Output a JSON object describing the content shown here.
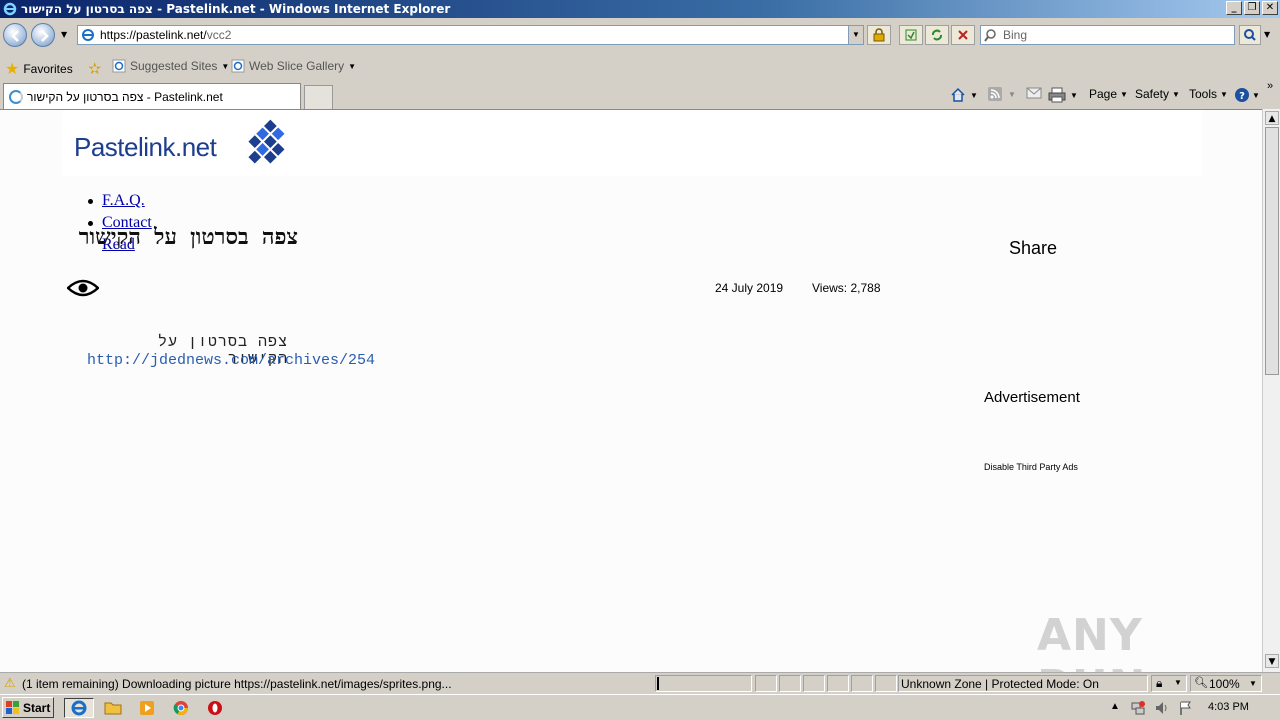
{
  "window": {
    "title": "צפה בסרטון על הקישור - Pastelink.net - Windows Internet Explorer",
    "controls": [
      "_",
      "❐",
      "✕"
    ]
  },
  "address": {
    "url_host": "https://pastelink.net/",
    "url_path": "vcc2"
  },
  "search": {
    "placeholder": "Bing"
  },
  "favorites": {
    "favorites_label": "Favorites",
    "suggested_sites": "Suggested Sites",
    "web_slice_gallery": "Web Slice Gallery"
  },
  "tab": {
    "title": "צפה בסרטון על הקישור - Pastelink.net"
  },
  "commandbar": {
    "page": "Page",
    "safety": "Safety",
    "tools": "Tools"
  },
  "site": {
    "logo": "Pastelink",
    "logo_tld": ".net",
    "nav": [
      "F.A.Q.",
      "Contact",
      "Read"
    ]
  },
  "post": {
    "title": "צפה בסרטון על הקישור",
    "date": "24 July 2019",
    "views": "Views: 2,788",
    "body_line": "צפה בסרטון על הקישור",
    "link": "http://jdednews.com/archives/254"
  },
  "sidebar": {
    "share": "Share",
    "advertisement": "Advertisement",
    "disable_ads": "Disable Third Party Ads"
  },
  "watermark": "ANY RUN",
  "statusbar": {
    "message": "(1 item remaining) Downloading picture https://pastelink.net/images/sprites.png...",
    "zone": "Unknown Zone | Protected Mode: On",
    "zoom": "100%"
  },
  "taskbar": {
    "start": "Start",
    "clock": "4:03 PM"
  },
  "colors": {
    "brand": "#1d3d8f",
    "link": "#2a5db0",
    "nav_link": "#0000aa"
  }
}
